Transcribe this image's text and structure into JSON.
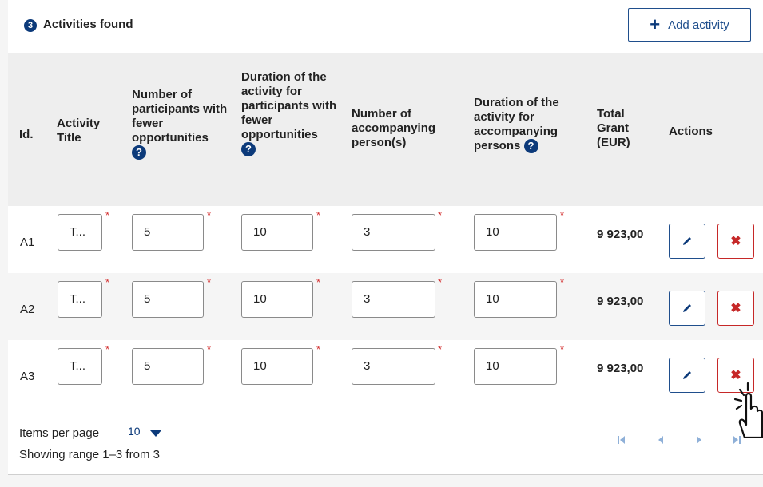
{
  "header": {
    "count_badge": "3",
    "title": "Activities found",
    "add_label": "Add activity"
  },
  "columns": {
    "id": "Id.",
    "title": "Activity Title",
    "participants": "Number of participants with fewer opportunities",
    "duration_participants": "Duration of the activity for participants with fewer opportunities",
    "accompanying": "Number of accompanying person(s)",
    "duration_accompanying": "Duration of the activity for accompanying persons",
    "total_grant": "Total Grant (EUR)",
    "actions": "Actions"
  },
  "rows": [
    {
      "id": "A1",
      "title": "T...",
      "participants": "5",
      "duration_participants": "10",
      "accompanying": "3",
      "duration_accompanying": "10",
      "grant": "9 923,00"
    },
    {
      "id": "A2",
      "title": "T...",
      "participants": "5",
      "duration_participants": "10",
      "accompanying": "3",
      "duration_accompanying": "10",
      "grant": "9 923,00"
    },
    {
      "id": "A3",
      "title": "T...",
      "participants": "5",
      "duration_participants": "10",
      "accompanying": "3",
      "duration_accompanying": "10",
      "grant": "9 923,00"
    }
  ],
  "required_mark": "*",
  "footer": {
    "items_per_page_label": "Items per page",
    "items_per_page_value": "10",
    "range_text": "Showing range 1–3 from 3"
  },
  "colors": {
    "primary": "#0c3a7a",
    "danger": "#c62828",
    "required": "#d32f2f"
  },
  "icons": [
    "plus-icon",
    "help-icon",
    "pencil-icon",
    "close-icon",
    "caret-down-icon",
    "first-page-icon",
    "prev-page-icon",
    "next-page-icon",
    "last-page-icon",
    "hand-pointer-icon"
  ]
}
